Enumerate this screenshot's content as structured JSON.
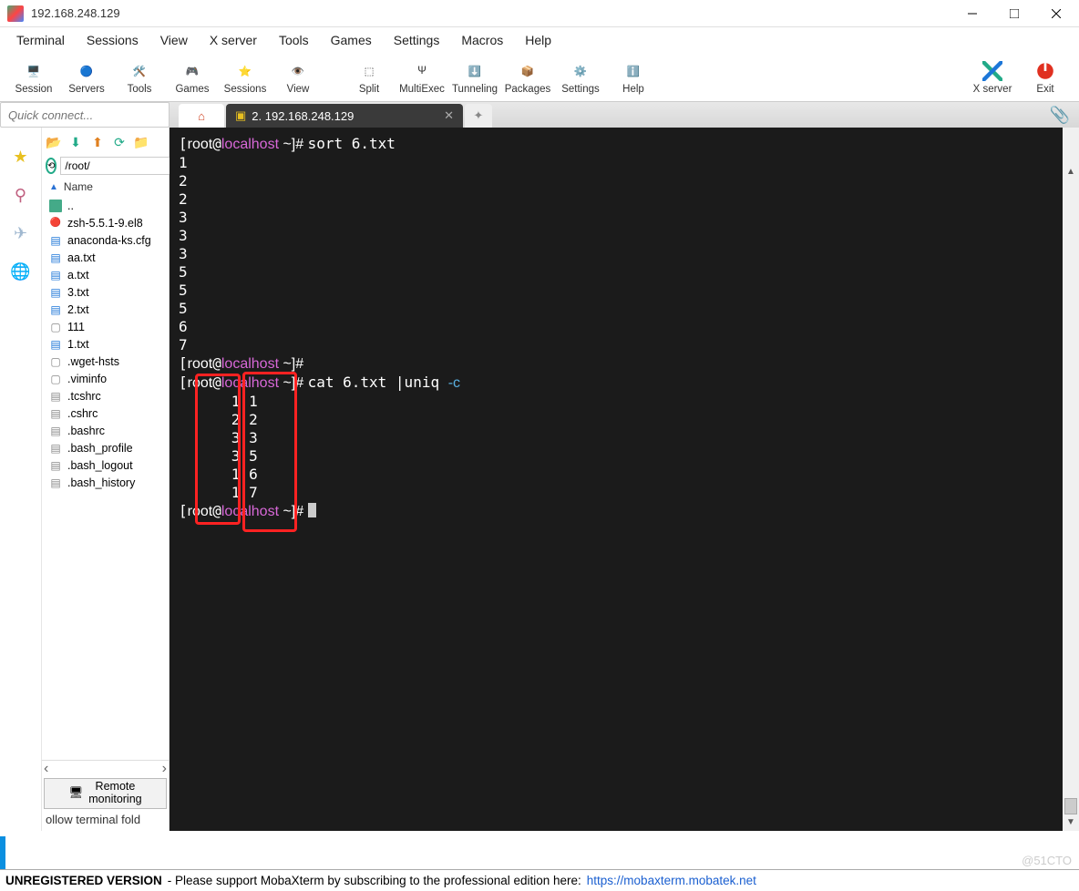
{
  "window": {
    "title": "192.168.248.129"
  },
  "menu": [
    "Terminal",
    "Sessions",
    "View",
    "X server",
    "Tools",
    "Games",
    "Settings",
    "Macros",
    "Help"
  ],
  "toolbar": [
    {
      "label": "Session",
      "color": "#1c76d8"
    },
    {
      "label": "Servers",
      "color": "#1c76d8"
    },
    {
      "label": "Tools",
      "color": "#e09020"
    },
    {
      "label": "Games",
      "color": "#888"
    },
    {
      "label": "Sessions",
      "color": "#e8c020"
    },
    {
      "label": "View",
      "color": "#2a8"
    },
    {
      "label": "Split",
      "color": "#1c76d8"
    },
    {
      "label": "MultiExec",
      "color": "#7030a0"
    },
    {
      "label": "Tunneling",
      "color": "#1c76d8"
    },
    {
      "label": "Packages",
      "color": "#e09020"
    },
    {
      "label": "Settings",
      "color": "#2a8"
    },
    {
      "label": "Help",
      "color": "#1c76d8"
    }
  ],
  "toolbar_right": [
    {
      "label": "X server"
    },
    {
      "label": "Exit"
    }
  ],
  "quick_connect_placeholder": "Quick connect...",
  "path_value": "/root/",
  "filelist_header": "Name",
  "files": [
    {
      "name": "..",
      "kind": "folder"
    },
    {
      "name": "zsh-5.5.1-9.el8",
      "kind": "bin"
    },
    {
      "name": "anaconda-ks.cfg",
      "kind": "txt"
    },
    {
      "name": "aa.txt",
      "kind": "txt"
    },
    {
      "name": "a.txt",
      "kind": "txt"
    },
    {
      "name": "3.txt",
      "kind": "txt"
    },
    {
      "name": "2.txt",
      "kind": "txt"
    },
    {
      "name": "111",
      "kind": "blank"
    },
    {
      "name": "1.txt",
      "kind": "txt"
    },
    {
      "name": ".wget-hsts",
      "kind": "blank"
    },
    {
      "name": ".viminfo",
      "kind": "blank"
    },
    {
      "name": ".tcshrc",
      "kind": "dot"
    },
    {
      "name": ".cshrc",
      "kind": "dot"
    },
    {
      "name": ".bashrc",
      "kind": "dot"
    },
    {
      "name": ".bash_profile",
      "kind": "dot"
    },
    {
      "name": ".bash_logout",
      "kind": "dot"
    },
    {
      "name": ".bash_history",
      "kind": "dot"
    }
  ],
  "remote_monitoring": "Remote\nmonitoring",
  "bottom_info": "ollow terminal fold",
  "tabs": {
    "active_label": "2. 192.168.248.129"
  },
  "terminal": {
    "prompt_user": "root",
    "prompt_at": "@",
    "prompt_host": "localhost",
    "prompt_rest": " ~]# ",
    "cmd1": "sort 6.txt",
    "sort_output": [
      "1",
      "2",
      "2",
      "3",
      "3",
      "3",
      "5",
      "5",
      "5",
      "6",
      "7"
    ],
    "cmd2_a": "cat 6.txt |uniq ",
    "cmd2_opt": "-c",
    "uniq_output": [
      "      1 1",
      "      2 2",
      "      3 3",
      "      3 5",
      "      1 6",
      "      1 7"
    ]
  },
  "status": {
    "label": "UNREGISTERED VERSION",
    "msg": "  -   Please support MobaXterm by subscribing to the professional edition here:  ",
    "url": "https://mobaxterm.mobatek.net"
  },
  "watermark": "@51CTO"
}
